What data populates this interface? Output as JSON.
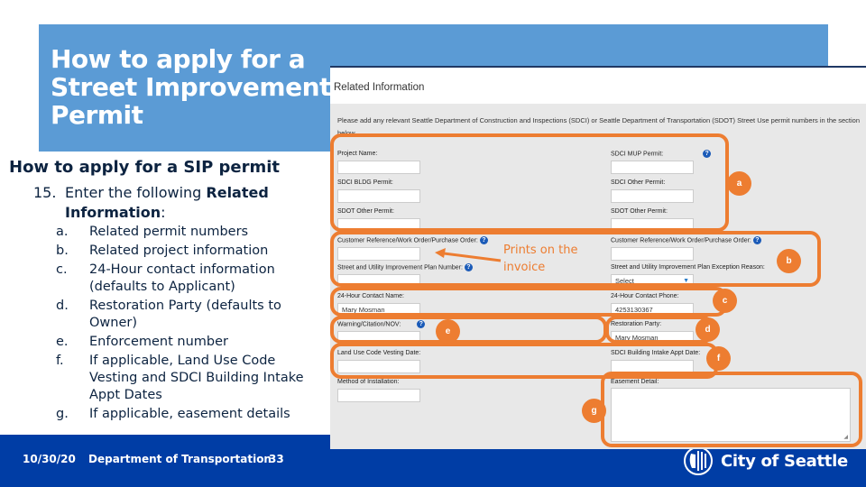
{
  "slide": {
    "title_lines": [
      "How to apply for a",
      "Street Improvement",
      "Permit"
    ],
    "section_heading": "How to apply for a SIP permit",
    "step": {
      "number": "15.",
      "text_prefix": "Enter the following ",
      "text_bold": "Related Information",
      "text_suffix": ":"
    },
    "list": [
      {
        "marker": "a.",
        "text": "Related permit numbers"
      },
      {
        "marker": "b.",
        "text": "Related project information"
      },
      {
        "marker": "c.",
        "text": "24-Hour contact information (defaults to Applicant)"
      },
      {
        "marker": "d.",
        "text": "Restoration Party (defaults to Owner)"
      },
      {
        "marker": "e.",
        "text": "Enforcement number"
      },
      {
        "marker": "f.",
        "text": "If applicable, Land Use Code Vesting and SDCI Building Intake Appt Dates"
      },
      {
        "marker": "g.",
        "text": "If applicable, easement details"
      }
    ],
    "annotation": "Prints on the invoice",
    "badges": [
      "a",
      "b",
      "c",
      "d",
      "e",
      "f",
      "g"
    ],
    "accent_color": "#ed7d31",
    "title_band_color": "#5b9bd5",
    "footer_color": "#003da5"
  },
  "footer": {
    "date": "10/30/20",
    "department": "Department of Transportation",
    "page": "33",
    "logo_text": "City of Seattle"
  },
  "screen": {
    "title": "Related Information",
    "intro": "Please add any relevant Seattle Department of Construction and Inspections (SDCI) or Seattle Department of Transportation (SDOT) Street Use permit numbers in the section below.",
    "fields": {
      "project_name": {
        "label": "Project Name:",
        "value": ""
      },
      "sdci_mup_permit": {
        "label": "SDCI MUP Permit:",
        "value": ""
      },
      "sdci_bldg_permit": {
        "label": "SDCI BLDG Permit:",
        "value": ""
      },
      "sdci_other_permit": {
        "label": "SDCI Other Permit:",
        "value": ""
      },
      "sdot_other_permit_left": {
        "label": "SDOT Other Permit:",
        "value": ""
      },
      "sdot_other_permit_right": {
        "label": "SDOT Other Permit:",
        "value": ""
      },
      "customer_ref_left": {
        "label": "Customer Reference/Work Order/Purchase Order:",
        "value": ""
      },
      "customer_ref_right": {
        "label": "Customer Reference/Work Order/Purchase Order:",
        "value": ""
      },
      "plan_number": {
        "label": "Street and Utility Improvement Plan Number:",
        "value": ""
      },
      "plan_exception_reason": {
        "label": "Street and Utility Improvement Plan Exception Reason:",
        "value": "Select"
      },
      "contact_name": {
        "label": "24-Hour Contact Name:",
        "value": "Mary Mosman"
      },
      "contact_phone": {
        "label": "24-Hour Contact Phone:",
        "value": "4253130367"
      },
      "warning_citation": {
        "label": "Warning/Citation/NOV:",
        "value": ""
      },
      "restoration_party": {
        "label": "Restoration Party:",
        "value": "Mary Mosman"
      },
      "land_use_vesting_date": {
        "label": "Land Use Code Vesting Date:",
        "value": ""
      },
      "sdci_intake_appt_date": {
        "label": "SDCI Building Intake Appt Date:",
        "value": ""
      },
      "method_of_installation": {
        "label": "Method of Installation:",
        "value": ""
      },
      "easement_detail": {
        "label": "Easement Detail:",
        "value": ""
      }
    },
    "help_glyph": "?",
    "select_caret": "▼"
  }
}
